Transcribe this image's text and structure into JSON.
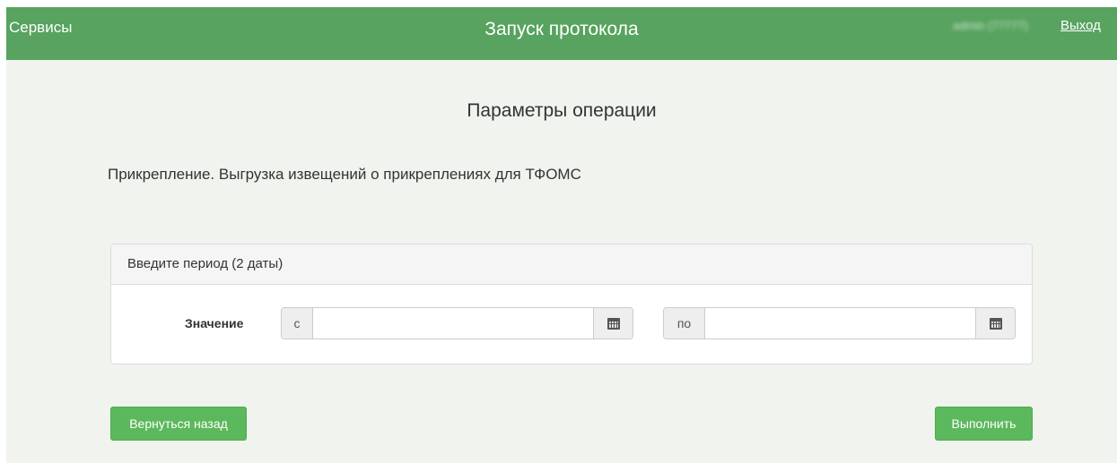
{
  "header": {
    "services_label": "Сервисы",
    "title": "Запуск протокола",
    "user_label": "admin (77777)",
    "logout_label": "Выход"
  },
  "main": {
    "heading": "Параметры операции",
    "operation_name": "Прикрепление. Выгрузка извещений о прикреплениях для ТФОМС",
    "period_panel": {
      "title": "Введите период (2 даты)",
      "field_label": "Значение",
      "from_prefix": "с",
      "from_value": "",
      "to_prefix": "по",
      "to_value": "",
      "calendar_icon": "calendar-icon"
    }
  },
  "footer": {
    "back_label": "Вернуться назад",
    "execute_label": "Выполнить"
  },
  "colors": {
    "header_bg": "#57a35f",
    "page_bg": "#f1f4ee",
    "button_green": "#5cb85c"
  }
}
